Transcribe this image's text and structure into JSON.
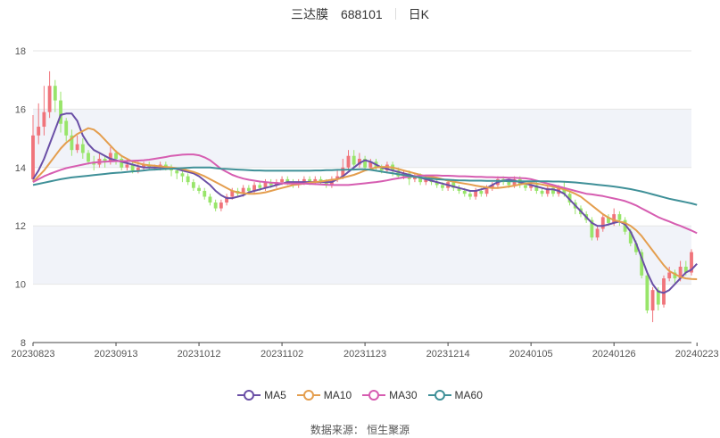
{
  "header": {
    "stock_name": "三达膜",
    "stock_code": "688101",
    "period": "日K"
  },
  "source_text": "数据来源： 恒生聚源",
  "colors": {
    "up": "#f0747b",
    "down": "#98e56a",
    "band": "#f1f3f9",
    "grid": "#e6e6e6",
    "axis": "#444444"
  },
  "chart_data": {
    "type": "candlestick",
    "title": "三达膜 688101 日K",
    "y_ticks": [
      "8",
      "10",
      "12",
      "14",
      "16",
      "18"
    ],
    "ylim": [
      8,
      18
    ],
    "x_tick_labels": [
      "20230823",
      "20230913",
      "20231012",
      "20231102",
      "20231123",
      "20231214",
      "20240105",
      "20240126",
      "20240223"
    ],
    "x_tick_index": [
      0,
      15,
      30,
      45,
      60,
      75,
      90,
      105,
      120
    ],
    "legend": [
      {
        "name": "MA5",
        "color": "#6a4fa6"
      },
      {
        "name": "MA10",
        "color": "#e49e4e"
      },
      {
        "name": "MA30",
        "color": "#d65db1"
      },
      {
        "name": "MA60",
        "color": "#3f9098"
      }
    ],
    "candles": [
      [
        13.6,
        15.1,
        15.8,
        13.5
      ],
      [
        15.1,
        15.4,
        16.2,
        14.8
      ],
      [
        15.4,
        15.9,
        16.8,
        15.1
      ],
      [
        15.9,
        16.8,
        17.3,
        15.7
      ],
      [
        16.8,
        16.3,
        17.0,
        15.9
      ],
      [
        16.3,
        15.5,
        16.6,
        15.2
      ],
      [
        15.6,
        15.1,
        15.7,
        14.9
      ],
      [
        15.1,
        14.6,
        15.3,
        14.4
      ],
      [
        14.6,
        14.8,
        15.1,
        14.5
      ],
      [
        14.8,
        14.5,
        15.0,
        14.3
      ],
      [
        14.5,
        14.2,
        14.6,
        14.1
      ],
      [
        14.2,
        14.1,
        14.4,
        13.9
      ],
      [
        14.1,
        14.3,
        14.5,
        14.0
      ],
      [
        14.3,
        14.2,
        14.4,
        14.0
      ],
      [
        14.2,
        14.5,
        14.7,
        14.1
      ],
      [
        14.5,
        14.3,
        14.6,
        14.1
      ],
      [
        14.3,
        14.0,
        14.4,
        13.9
      ],
      [
        14.0,
        14.1,
        14.3,
        13.9
      ],
      [
        14.1,
        13.9,
        14.2,
        13.8
      ],
      [
        13.9,
        14.0,
        14.2,
        13.8
      ],
      [
        14.0,
        14.1,
        14.2,
        13.9
      ],
      [
        14.1,
        14.0,
        14.2,
        13.9
      ],
      [
        14.0,
        14.0,
        14.1,
        13.9
      ],
      [
        14.0,
        14.1,
        14.2,
        13.9
      ],
      [
        14.1,
        14.0,
        14.2,
        13.9
      ],
      [
        14.0,
        13.9,
        14.1,
        13.7
      ],
      [
        13.9,
        13.8,
        14.0,
        13.6
      ],
      [
        13.8,
        13.7,
        13.9,
        13.5
      ],
      [
        13.7,
        13.5,
        13.8,
        13.4
      ],
      [
        13.5,
        13.3,
        13.6,
        13.2
      ],
      [
        13.3,
        13.2,
        13.4,
        13.1
      ],
      [
        13.2,
        13.0,
        13.3,
        12.9
      ],
      [
        13.0,
        12.8,
        13.1,
        12.7
      ],
      [
        12.8,
        12.6,
        12.9,
        12.5
      ],
      [
        12.6,
        12.8,
        12.9,
        12.5
      ],
      [
        12.8,
        13.0,
        13.1,
        12.7
      ],
      [
        13.0,
        13.2,
        13.3,
        12.9
      ],
      [
        13.2,
        13.1,
        13.3,
        13.0
      ],
      [
        13.1,
        13.3,
        13.4,
        13.0
      ],
      [
        13.3,
        13.2,
        13.4,
        13.1
      ],
      [
        13.2,
        13.4,
        13.5,
        13.1
      ],
      [
        13.4,
        13.3,
        13.5,
        13.2
      ],
      [
        13.3,
        13.5,
        13.6,
        13.2
      ],
      [
        13.5,
        13.4,
        13.6,
        13.3
      ],
      [
        13.4,
        13.5,
        13.6,
        13.3
      ],
      [
        13.5,
        13.6,
        13.7,
        13.4
      ],
      [
        13.6,
        13.5,
        13.7,
        13.4
      ],
      [
        13.5,
        13.4,
        13.6,
        13.3
      ],
      [
        13.4,
        13.5,
        13.6,
        13.3
      ],
      [
        13.5,
        13.6,
        13.7,
        13.4
      ],
      [
        13.6,
        13.5,
        13.7,
        13.4
      ],
      [
        13.5,
        13.6,
        13.7,
        13.4
      ],
      [
        13.6,
        13.5,
        13.7,
        13.4
      ],
      [
        13.5,
        13.4,
        13.6,
        13.3
      ],
      [
        13.4,
        13.6,
        13.7,
        13.3
      ],
      [
        13.6,
        13.7,
        13.9,
        13.5
      ],
      [
        13.7,
        14.0,
        14.3,
        13.6
      ],
      [
        14.0,
        14.4,
        14.6,
        13.9
      ],
      [
        14.4,
        14.1,
        14.6,
        14.0
      ],
      [
        14.1,
        14.3,
        14.5,
        14.0
      ],
      [
        14.3,
        14.0,
        14.4,
        13.9
      ],
      [
        14.0,
        14.2,
        14.3,
        13.9
      ],
      [
        14.2,
        14.0,
        14.3,
        13.9
      ],
      [
        14.0,
        13.9,
        14.1,
        13.8
      ],
      [
        13.9,
        14.1,
        14.2,
        13.8
      ],
      [
        14.1,
        13.9,
        14.2,
        13.7
      ],
      [
        13.9,
        13.7,
        14.0,
        13.6
      ],
      [
        13.7,
        13.8,
        13.9,
        13.6
      ],
      [
        13.8,
        13.6,
        13.9,
        13.4
      ],
      [
        13.6,
        13.7,
        13.8,
        13.5
      ],
      [
        13.7,
        13.5,
        13.8,
        13.4
      ],
      [
        13.5,
        13.6,
        13.7,
        13.4
      ],
      [
        13.6,
        13.5,
        13.7,
        13.4
      ],
      [
        13.5,
        13.4,
        13.6,
        13.3
      ],
      [
        13.4,
        13.3,
        13.5,
        13.2
      ],
      [
        13.3,
        13.5,
        13.6,
        13.2
      ],
      [
        13.5,
        13.3,
        13.6,
        13.2
      ],
      [
        13.3,
        13.2,
        13.4,
        13.1
      ],
      [
        13.2,
        13.1,
        13.3,
        13.0
      ],
      [
        13.1,
        13.0,
        13.2,
        12.9
      ],
      [
        13.0,
        13.2,
        13.3,
        12.9
      ],
      [
        13.2,
        13.1,
        13.3,
        13.0
      ],
      [
        13.1,
        13.3,
        13.4,
        13.0
      ],
      [
        13.3,
        13.4,
        13.5,
        13.2
      ],
      [
        13.4,
        13.6,
        13.7,
        13.3
      ],
      [
        13.6,
        13.5,
        13.7,
        13.4
      ],
      [
        13.5,
        13.4,
        13.6,
        13.3
      ],
      [
        13.4,
        13.6,
        13.7,
        13.3
      ],
      [
        13.6,
        13.4,
        13.7,
        13.3
      ],
      [
        13.4,
        13.3,
        13.5,
        13.2
      ],
      [
        13.3,
        13.4,
        13.5,
        13.2
      ],
      [
        13.4,
        13.2,
        13.5,
        13.1
      ],
      [
        13.2,
        13.1,
        13.3,
        13.0
      ],
      [
        13.1,
        13.3,
        13.4,
        13.0
      ],
      [
        13.3,
        13.1,
        13.4,
        13.0
      ],
      [
        13.1,
        13.3,
        13.4,
        13.0
      ],
      [
        13.3,
        13.1,
        13.5,
        13.0
      ],
      [
        13.1,
        12.8,
        13.2,
        12.7
      ],
      [
        12.8,
        12.6,
        12.9,
        12.4
      ],
      [
        12.6,
        12.4,
        12.7,
        12.3
      ],
      [
        12.4,
        12.2,
        12.5,
        12.1
      ],
      [
        12.2,
        11.6,
        12.3,
        11.5
      ],
      [
        11.6,
        11.9,
        12.0,
        11.5
      ],
      [
        11.9,
        12.3,
        12.4,
        11.8
      ],
      [
        12.3,
        12.1,
        12.4,
        12.0
      ],
      [
        12.1,
        12.4,
        12.6,
        12.0
      ],
      [
        12.4,
        12.2,
        12.5,
        12.0
      ],
      [
        12.2,
        11.8,
        12.3,
        11.7
      ],
      [
        11.8,
        11.4,
        11.9,
        11.3
      ],
      [
        11.4,
        11.1,
        11.5,
        11.0
      ],
      [
        11.1,
        10.3,
        11.2,
        10.2
      ],
      [
        10.3,
        9.1,
        10.4,
        9.0
      ],
      [
        9.1,
        9.8,
        9.9,
        8.7
      ],
      [
        9.8,
        9.3,
        9.9,
        9.1
      ],
      [
        9.3,
        10.2,
        10.3,
        9.2
      ],
      [
        10.2,
        10.4,
        10.6,
        10.1
      ],
      [
        10.4,
        10.2,
        10.5,
        10.0
      ],
      [
        10.2,
        10.6,
        10.8,
        10.1
      ],
      [
        10.6,
        10.4,
        10.8,
        10.3
      ],
      [
        10.4,
        11.1,
        11.2,
        10.3
      ]
    ],
    "ma": {
      "MA5": [
        13.6,
        13.9,
        14.3,
        14.8,
        15.3,
        15.8,
        15.85,
        15.85,
        15.6,
        15.1,
        14.8,
        14.6,
        14.5,
        14.4,
        14.3,
        14.25,
        14.2,
        14.15,
        14.1,
        14.05,
        14.0,
        14.0,
        14.0,
        14.0,
        14.0,
        13.98,
        13.95,
        13.9,
        13.85,
        13.8,
        13.7,
        13.55,
        13.4,
        13.2,
        13.05,
        12.95,
        12.95,
        13.0,
        13.05,
        13.15,
        13.2,
        13.25,
        13.3,
        13.35,
        13.4,
        13.45,
        13.5,
        13.5,
        13.5,
        13.5,
        13.5,
        13.5,
        13.5,
        13.5,
        13.5,
        13.6,
        13.7,
        13.85,
        14.0,
        14.15,
        14.25,
        14.2,
        14.1,
        14.0,
        13.95,
        13.9,
        13.85,
        13.8,
        13.75,
        13.7,
        13.65,
        13.6,
        13.55,
        13.5,
        13.45,
        13.4,
        13.35,
        13.3,
        13.25,
        13.2,
        13.2,
        13.25,
        13.3,
        13.4,
        13.5,
        13.55,
        13.58,
        13.55,
        13.5,
        13.45,
        13.4,
        13.35,
        13.3,
        13.25,
        13.25,
        13.2,
        13.1,
        12.9,
        12.7,
        12.5,
        12.3,
        12.1,
        12.0,
        12.0,
        12.05,
        12.1,
        12.15,
        12.05,
        11.8,
        11.4,
        10.9,
        10.4,
        10.0,
        9.75,
        9.7,
        9.8,
        10.0,
        10.2,
        10.4,
        10.5,
        10.7
      ],
      "MA10": [
        13.5,
        13.7,
        13.9,
        14.15,
        14.4,
        14.65,
        14.85,
        15.0,
        15.15,
        15.25,
        15.35,
        15.3,
        15.15,
        14.95,
        14.75,
        14.55,
        14.4,
        14.3,
        14.2,
        14.15,
        14.1,
        14.08,
        14.06,
        14.04,
        14.02,
        14.0,
        13.98,
        13.95,
        13.9,
        13.85,
        13.78,
        13.7,
        13.6,
        13.5,
        13.4,
        13.3,
        13.2,
        13.15,
        13.12,
        13.1,
        13.1,
        13.12,
        13.15,
        13.2,
        13.25,
        13.3,
        13.35,
        13.4,
        13.42,
        13.45,
        13.48,
        13.5,
        13.52,
        13.55,
        13.58,
        13.6,
        13.65,
        13.7,
        13.75,
        13.82,
        13.9,
        13.95,
        14.0,
        14.02,
        14.02,
        14.0,
        13.95,
        13.9,
        13.85,
        13.8,
        13.75,
        13.7,
        13.68,
        13.65,
        13.6,
        13.55,
        13.52,
        13.48,
        13.45,
        13.42,
        13.38,
        13.35,
        13.32,
        13.3,
        13.3,
        13.32,
        13.35,
        13.38,
        13.42,
        13.45,
        13.47,
        13.45,
        13.42,
        13.38,
        13.35,
        13.3,
        13.25,
        13.18,
        13.1,
        13.0,
        12.85,
        12.7,
        12.55,
        12.4,
        12.28,
        12.2,
        12.15,
        12.1,
        12.0,
        11.85,
        11.65,
        11.4,
        11.15,
        10.9,
        10.65,
        10.45,
        10.35,
        10.25,
        10.2,
        10.18,
        10.17
      ],
      "MA30": [
        13.5,
        13.6,
        13.7,
        13.78,
        13.85,
        13.92,
        13.98,
        14.02,
        14.06,
        14.1,
        14.14,
        14.17,
        14.19,
        14.2,
        14.21,
        14.22,
        14.22,
        14.22,
        14.23,
        14.24,
        14.25,
        14.27,
        14.3,
        14.33,
        14.36,
        14.4,
        14.42,
        14.44,
        14.45,
        14.45,
        14.42,
        14.35,
        14.25,
        14.1,
        13.95,
        13.85,
        13.75,
        13.68,
        13.62,
        13.58,
        13.55,
        13.52,
        13.5,
        13.48,
        13.47,
        13.46,
        13.45,
        13.45,
        13.45,
        13.45,
        13.44,
        13.43,
        13.42,
        13.41,
        13.4,
        13.4,
        13.4,
        13.4,
        13.42,
        13.44,
        13.46,
        13.48,
        13.5,
        13.53,
        13.56,
        13.6,
        13.63,
        13.66,
        13.68,
        13.7,
        13.72,
        13.73,
        13.73,
        13.73,
        13.72,
        13.72,
        13.71,
        13.7,
        13.7,
        13.69,
        13.68,
        13.68,
        13.67,
        13.67,
        13.66,
        13.66,
        13.65,
        13.65,
        13.64,
        13.63,
        13.6,
        13.55,
        13.5,
        13.45,
        13.4,
        13.35,
        13.3,
        13.25,
        13.2,
        13.15,
        13.1,
        13.08,
        13.05,
        13.02,
        12.98,
        12.94,
        12.9,
        12.85,
        12.78,
        12.7,
        12.6,
        12.5,
        12.4,
        12.3,
        12.22,
        12.15,
        12.07,
        12.0,
        11.92,
        11.84,
        11.75
      ],
      "MA60": [
        13.4,
        13.44,
        13.48,
        13.52,
        13.56,
        13.6,
        13.63,
        13.66,
        13.68,
        13.7,
        13.72,
        13.74,
        13.76,
        13.78,
        13.8,
        13.82,
        13.83,
        13.85,
        13.87,
        13.88,
        13.9,
        13.92,
        13.93,
        13.94,
        13.95,
        13.96,
        13.97,
        13.98,
        13.99,
        14.0,
        14.0,
        14.0,
        14.0,
        13.98,
        13.96,
        13.95,
        13.94,
        13.93,
        13.92,
        13.91,
        13.9,
        13.9,
        13.89,
        13.89,
        13.89,
        13.89,
        13.89,
        13.89,
        13.89,
        13.89,
        13.89,
        13.9,
        13.9,
        13.91,
        13.91,
        13.92,
        13.92,
        13.93,
        13.93,
        13.94,
        13.94,
        13.92,
        13.89,
        13.86,
        13.83,
        13.8,
        13.77,
        13.74,
        13.71,
        13.68,
        13.66,
        13.64,
        13.62,
        13.6,
        13.59,
        13.58,
        13.57,
        13.56,
        13.56,
        13.55,
        13.55,
        13.55,
        13.54,
        13.54,
        13.54,
        13.54,
        13.53,
        13.53,
        13.53,
        13.53,
        13.53,
        13.53,
        13.53,
        13.53,
        13.52,
        13.52,
        13.51,
        13.5,
        13.49,
        13.47,
        13.45,
        13.43,
        13.41,
        13.39,
        13.37,
        13.35,
        13.32,
        13.29,
        13.26,
        13.22,
        13.18,
        13.13,
        13.08,
        13.03,
        12.98,
        12.93,
        12.89,
        12.85,
        12.81,
        12.77,
        12.72
      ]
    }
  }
}
